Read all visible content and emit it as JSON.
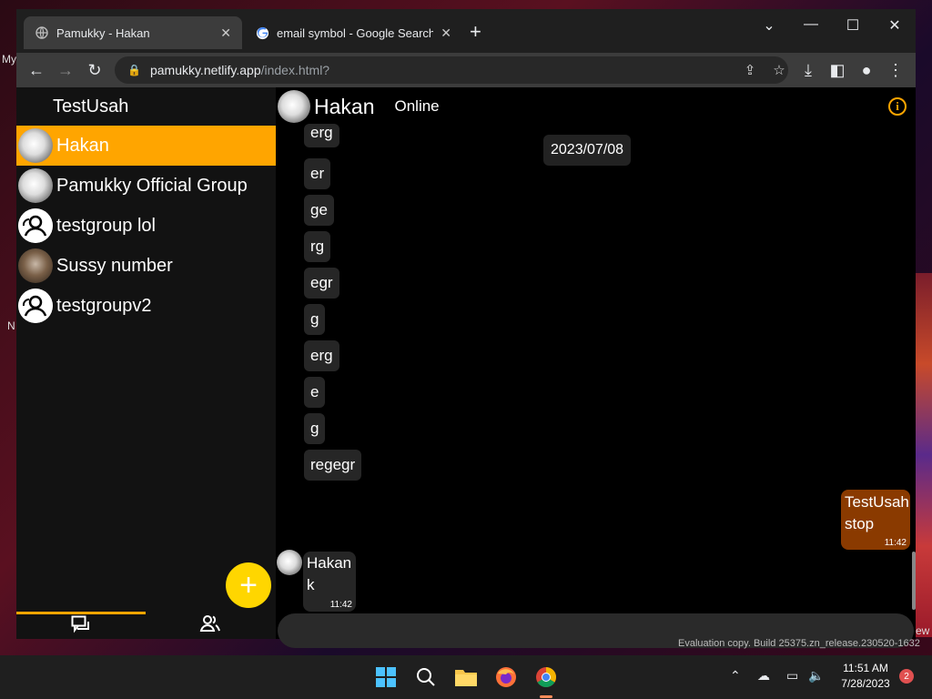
{
  "desktop": {
    "left_hints": [
      "My",
      "N"
    ],
    "right_hint": "ew",
    "eval_text": "Evaluation copy. Build 25375.zn_release.230520-1632"
  },
  "browser": {
    "tabs": [
      {
        "title": "Pamukky - Hakan",
        "active": true,
        "icon": "globe-icon"
      },
      {
        "title": "email symbol - Google Search",
        "active": false,
        "icon": "google-icon"
      }
    ],
    "url_domain": "pamukky.netlify.app",
    "url_path": "/index.html?"
  },
  "sidebar": {
    "current_user": "TestUsah",
    "chats": [
      {
        "name": "Hakan",
        "avatar": "img",
        "active": true
      },
      {
        "name": "Pamukky Official Group",
        "avatar": "img",
        "active": false
      },
      {
        "name": "testgroup lol",
        "avatar": "group",
        "active": false
      },
      {
        "name": "Sussy number",
        "avatar": "photo",
        "active": false
      },
      {
        "name": "testgroupv2",
        "avatar": "group",
        "active": false
      }
    ],
    "fab_label": "+"
  },
  "chat": {
    "contact_name": "Hakan",
    "status": "Online",
    "date_label": "2023/07/08",
    "messages": [
      "erg",
      "er",
      "ge",
      "rg",
      "egr",
      "g",
      "erg",
      "e",
      "g",
      "regegr"
    ],
    "outgoing": {
      "sender": "TestUsah",
      "text": "stop",
      "time": "11:42"
    },
    "incoming": {
      "sender": "Hakan",
      "text": "k",
      "time": "11:42"
    }
  },
  "taskbar": {
    "time": "11:51 AM",
    "date": "7/28/2023",
    "notifications": "2"
  },
  "colors": {
    "accent": "#ffa500",
    "fab": "#ffd600",
    "outgoing_bubble": "#8a3a00"
  }
}
